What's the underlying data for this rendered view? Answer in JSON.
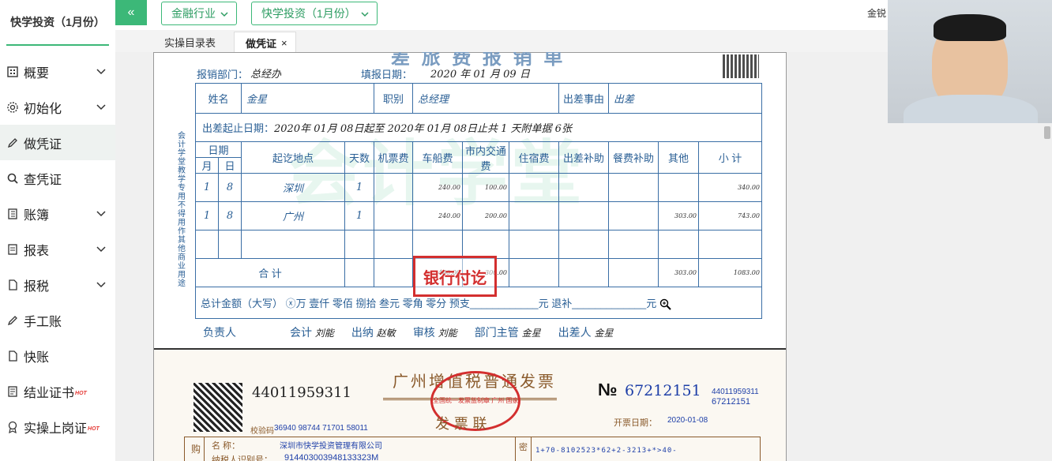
{
  "app": {
    "brand": "快学投资（1月份）"
  },
  "sidebar": {
    "items": [
      {
        "label": "概要",
        "icon": "grid-icon",
        "has_arrow": true
      },
      {
        "label": "初始化",
        "icon": "gear-icon",
        "has_arrow": true
      },
      {
        "label": "做凭证",
        "icon": "pen-icon",
        "has_arrow": false,
        "active": true
      },
      {
        "label": "查凭证",
        "icon": "search-icon",
        "has_arrow": false
      },
      {
        "label": "账簿",
        "icon": "book-icon",
        "has_arrow": true
      },
      {
        "label": "报表",
        "icon": "report-icon",
        "has_arrow": true
      },
      {
        "label": "报税",
        "icon": "document-icon",
        "has_arrow": true
      },
      {
        "label": "手工账",
        "icon": "pen-icon",
        "has_arrow": false
      },
      {
        "label": "快账",
        "icon": "document-icon",
        "has_arrow": false
      },
      {
        "label": "结业证书",
        "icon": "certificate-icon",
        "has_arrow": false,
        "badge": "HOT"
      },
      {
        "label": "实操上岗证",
        "icon": "badge-icon",
        "has_arrow": false,
        "badge": "HOT"
      }
    ]
  },
  "topbar": {
    "collapse_icon": "«",
    "industry": "金融行业",
    "company": "快学投资（1月份）",
    "user": "金锐"
  },
  "tabs": [
    {
      "label": "实操目录表",
      "active": false
    },
    {
      "label": "做凭证",
      "active": true,
      "close": "×"
    }
  ],
  "expense_form": {
    "title_fragment": "差 旅 费 报 销 单",
    "dept_label": "报销部门：",
    "dept": "总经办",
    "date_label": "填报日期：",
    "date": "2020 年   01 月 09 日",
    "name_label": "姓名",
    "name": "金星",
    "position_label": "职别",
    "position": "总经理",
    "reason_label": "出差事由",
    "reason": "出差",
    "period_label": "出差起止日期：",
    "period": "2020年  01月  08日起至  2020年  01月  08日止共   1   天附单据   6张",
    "side_text": "会计学堂教学专用 不得用作其他商业用途",
    "headers": {
      "date": "日期",
      "month": "月",
      "day": "日",
      "place": "起讫地点",
      "days": "天数",
      "air": "机票费",
      "car": "车船费",
      "local": "市内交通费",
      "hotel": "住宿费",
      "trip_allow": "出差补助",
      "meal_allow": "餐费补助",
      "other": "其他",
      "subtotal": "小 计"
    },
    "rows": [
      {
        "m": "1",
        "d": "8",
        "place": "深圳",
        "days": "1",
        "car": "240.00",
        "local": "100.00",
        "other": "",
        "subtotal": "340.00"
      },
      {
        "m": "1",
        "d": "8",
        "place": "广州",
        "days": "1",
        "car": "240.00",
        "local": "200.00",
        "other": "303.00",
        "subtotal": "743.00"
      }
    ],
    "total_label": "合  计",
    "total_car": "480.00",
    "total_local": "300.00",
    "total_other": "303.00",
    "total_subtotal": "1083.00",
    "amount_cap": "总计金额（大写） ⓧ万  壹仟  零佰  捌拾  叁元  零角  零分   预支____________元  退补_____________元",
    "stamp": "银行付讫",
    "signers": [
      {
        "role": "负责人",
        "name": ""
      },
      {
        "role": "会计",
        "name": "刘能"
      },
      {
        "role": "出纳",
        "name": "赵敏"
      },
      {
        "role": "审核",
        "name": "刘能"
      },
      {
        "role": "部门主管",
        "name": "金星"
      },
      {
        "role": "出差人",
        "name": "金星"
      }
    ]
  },
  "invoice": {
    "code": "44011959311",
    "title": "广州增值税普通发票",
    "subtitle": "发  票  联",
    "seal": "全国统一发票监制章 广州 国家税务总局监制",
    "no_symbol": "№",
    "no": "67212151",
    "code_small": "44011959311",
    "no_small": "67212151",
    "date_label": "开票日期：",
    "date": "2020-01-08",
    "check_label": "校验码",
    "check": "36940 98744 71701 58011",
    "buyer_label": "购",
    "name_label": "名    称：",
    "buyer_name": "深圳市快学投资管理有限公司",
    "taxid_label": "纳税人识别号：",
    "taxid": "914403003948133323M",
    "cipher_label": "密",
    "cipher": "1+70-8102523*62+2-3213+*>40-"
  },
  "colors": {
    "accent": "#3cb878",
    "form_blue": "#2a5f95",
    "stamp_red": "#d32f2f"
  }
}
